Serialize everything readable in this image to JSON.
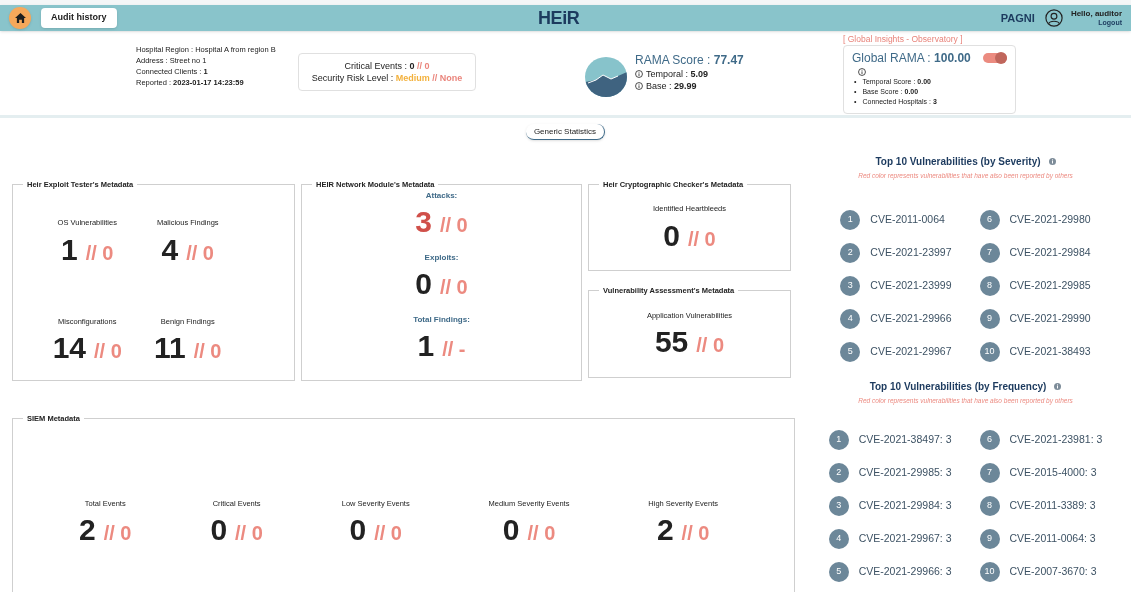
{
  "header": {
    "audit_button": "Audit history",
    "logo": "HEiR",
    "user_label": "PAGNI",
    "greeting": "Hello, auditor",
    "logout": "Logout"
  },
  "hospital_info": [
    "Hospital Region : Hospital A from region B",
    "Address : Street no 1",
    "Connected Clients : **1**",
    "Reported : **2023-01-17 14:23:59**"
  ],
  "events_box": {
    "critical": {
      "label": "Critical Events : ",
      "value": "0",
      "global": "// 0"
    },
    "risk": {
      "label": "Security Risk Level : ",
      "value": "Medium",
      "global": "// None"
    }
  },
  "rama": {
    "title": "RAMA Score : ",
    "value": "77.47",
    "temporal_label": "Temporal : ",
    "temporal": "5.09",
    "base_label": "Base : ",
    "base": "29.99"
  },
  "global_rama": {
    "caption": "[ Global Insights - Observatory ]",
    "title": "Global RAMA : ",
    "value": "100.00",
    "on": true,
    "details": [
      {
        "bullet": "•",
        "text": "Temporal Score : **0.00**"
      },
      {
        "bullet": "•",
        "text": "Base Score : **0.00**"
      },
      {
        "bullet": "•",
        "text": "Connected Hospitals : **3**"
      }
    ]
  },
  "generic_statistics": "Generic Statistics",
  "cards": [
    {
      "kind": "grid",
      "title": "Heir Exploit Tester's Metadata",
      "stats": [
        {
          "label": "OS Vulnerabilities",
          "value": "1",
          "global": "// 0"
        },
        {
          "label": "Malicious Findings",
          "value": "4",
          "global": "// 0"
        },
        {
          "label": "Misconfigurations",
          "value": "14",
          "global": "// 0"
        },
        {
          "label": "Benign Findings",
          "value": "11",
          "global": "// 0"
        }
      ]
    },
    {
      "kind": "stack",
      "title": "HEIR Network Module's Metadata",
      "stats": [
        {
          "label": "Attacks:",
          "value": "3",
          "global": "// 0",
          "alert": true
        },
        {
          "label": "Exploits:",
          "value": "0",
          "global": "// 0",
          "alert": false
        },
        {
          "label": "Total Findings:",
          "value": "1",
          "global": "// -",
          "alert": false
        }
      ]
    },
    {
      "kind": "single",
      "title": "Heir Cryptographic Checker's Metadata",
      "stats": [
        {
          "label": "Identified Heartbleeds",
          "value": "0",
          "global": "// 0"
        }
      ]
    },
    {
      "kind": "single",
      "title": "Vulnerability Assessment's Metadata",
      "stats": [
        {
          "label": "Application Vulnerabilities",
          "value": "55",
          "global": "// 0"
        }
      ]
    },
    {
      "kind": "row",
      "title": "SIEM Metadata",
      "stats": [
        {
          "label": "Total Events",
          "value": "2",
          "global": "// 0"
        },
        {
          "label": "Critical Events",
          "value": "0",
          "global": "// 0"
        },
        {
          "label": "Low Severity Events",
          "value": "0",
          "global": "// 0"
        },
        {
          "label": "Medium Severity Events",
          "value": "0",
          "global": "// 0"
        },
        {
          "label": "High Severity Events",
          "value": "2",
          "global": "// 0"
        }
      ]
    }
  ],
  "top_lists": [
    {
      "title": "Top 10 Vulnerabilities (by Severity)",
      "note": "Red color represents vulnerabilities that have also been reported by others",
      "items": [
        {
          "rank": "1",
          "cve": "CVE-2011-0064"
        },
        {
          "rank": "2",
          "cve": "CVE-2021-23997"
        },
        {
          "rank": "3",
          "cve": "CVE-2021-23999"
        },
        {
          "rank": "4",
          "cve": "CVE-2021-29966"
        },
        {
          "rank": "5",
          "cve": "CVE-2021-29967"
        },
        {
          "rank": "6",
          "cve": "CVE-2021-29980"
        },
        {
          "rank": "7",
          "cve": "CVE-2021-29984"
        },
        {
          "rank": "8",
          "cve": "CVE-2021-29985"
        },
        {
          "rank": "9",
          "cve": "CVE-2021-29990"
        },
        {
          "rank": "10",
          "cve": "CVE-2021-38493"
        }
      ]
    },
    {
      "title": "Top 10 Vulnerabilities (by Frequency)",
      "note": "Red color represents vulnerabilities that have also been reported by others",
      "items": [
        {
          "rank": "1",
          "cve": "CVE-2021-38497: 3"
        },
        {
          "rank": "2",
          "cve": "CVE-2021-29985: 3"
        },
        {
          "rank": "3",
          "cve": "CVE-2021-29984: 3"
        },
        {
          "rank": "4",
          "cve": "CVE-2021-29967: 3"
        },
        {
          "rank": "5",
          "cve": "CVE-2021-29966: 3"
        },
        {
          "rank": "6",
          "cve": "CVE-2021-23981: 3"
        },
        {
          "rank": "7",
          "cve": "CVE-2015-4000: 3"
        },
        {
          "rank": "8",
          "cve": "CVE-2011-3389: 3"
        },
        {
          "rank": "9",
          "cve": "CVE-2011-0064: 3"
        },
        {
          "rank": "10",
          "cve": "CVE-2007-3670: 3"
        }
      ]
    }
  ]
}
